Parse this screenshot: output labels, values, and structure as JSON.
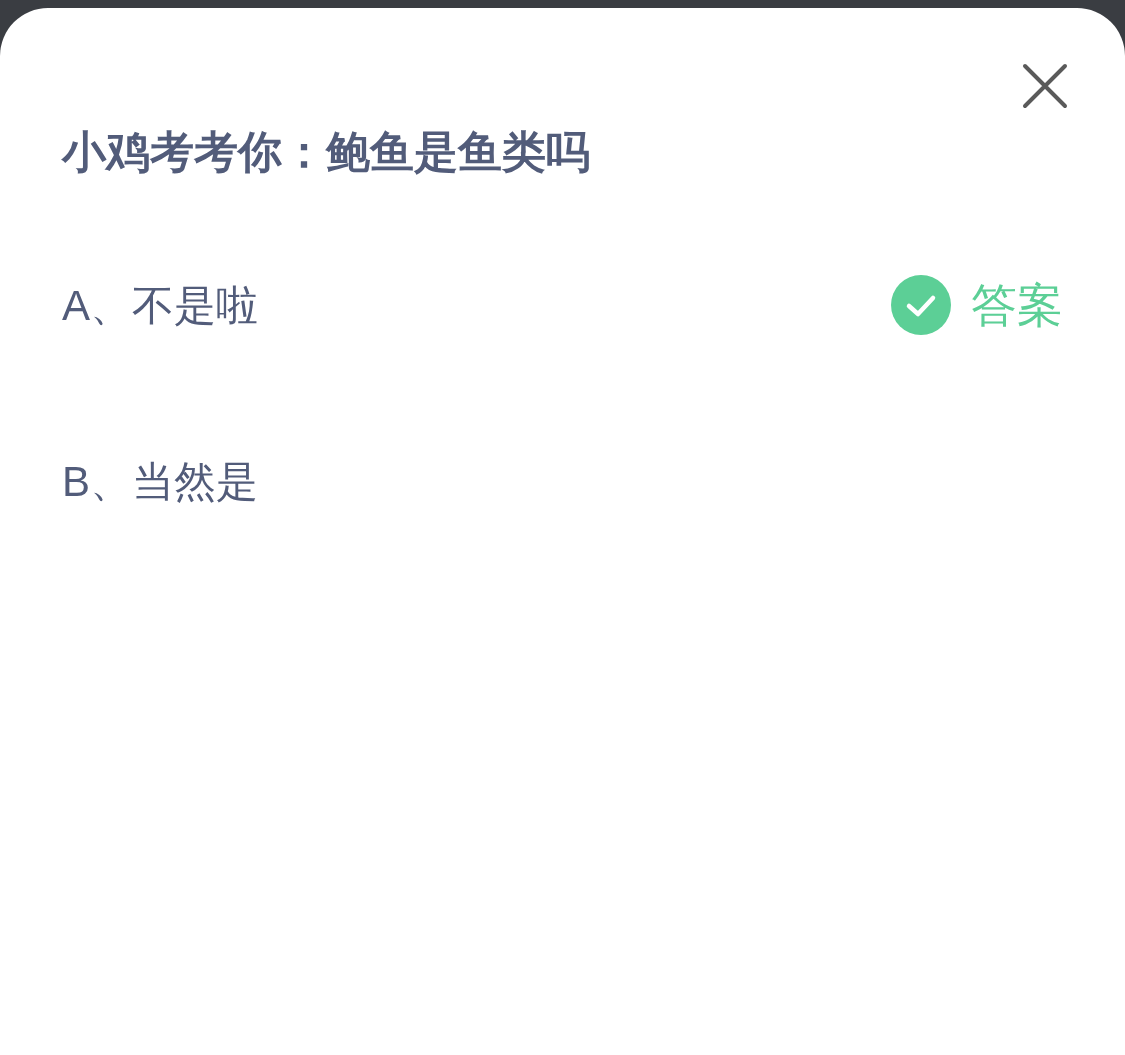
{
  "question": "小鸡考考你：鲍鱼是鱼类吗",
  "answer_label": "答案",
  "options": [
    {
      "text": "A、不是啦",
      "correct": true
    },
    {
      "text": "B、当然是",
      "correct": false
    }
  ]
}
